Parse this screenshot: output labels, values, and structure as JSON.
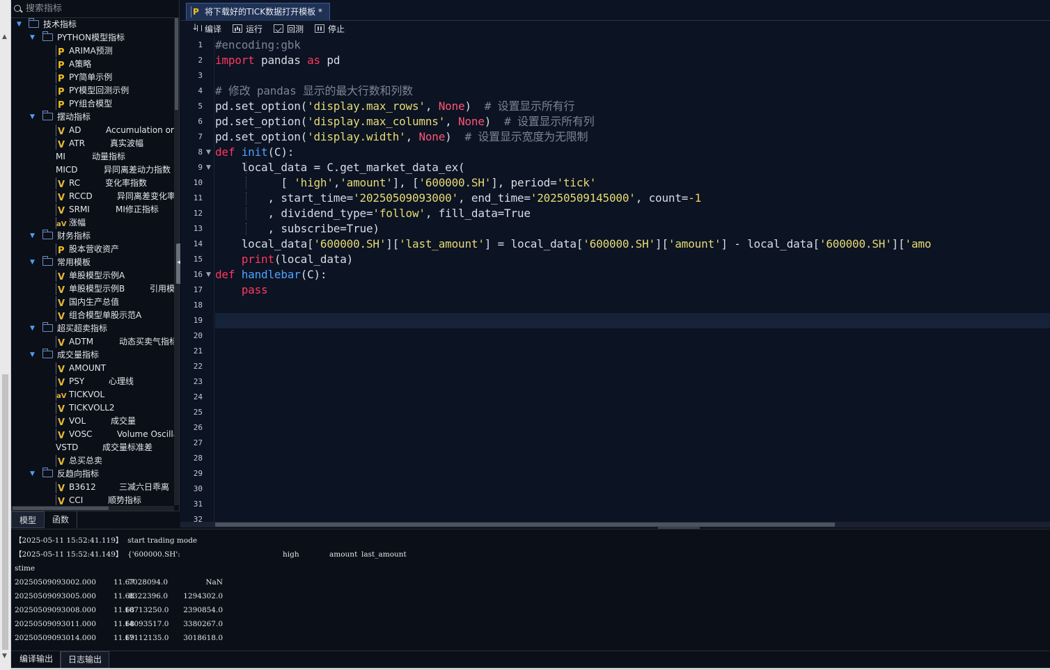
{
  "search": {
    "placeholder": "搜索指标"
  },
  "tree": [
    {
      "type": "group",
      "level": 0,
      "label": "技术指标"
    },
    {
      "type": "group",
      "level": 1,
      "label": "PYTHON模型指标"
    },
    {
      "type": "item",
      "icon": "p",
      "label": "ARIMA预测",
      "desc": ""
    },
    {
      "type": "item",
      "icon": "p",
      "label": "A策略",
      "desc": ""
    },
    {
      "type": "item",
      "icon": "p",
      "label": "PY简单示例",
      "desc": ""
    },
    {
      "type": "item",
      "icon": "p",
      "label": "PY模型回测示例",
      "desc": ""
    },
    {
      "type": "item",
      "icon": "p",
      "label": "PY组合模型",
      "desc": ""
    },
    {
      "type": "group",
      "level": 1,
      "label": "摆动指标"
    },
    {
      "type": "item",
      "icon": "v",
      "label": "AD",
      "desc": "Accumulation or"
    },
    {
      "type": "item",
      "icon": "v",
      "label": "ATR",
      "desc": "真实波幅"
    },
    {
      "type": "item",
      "icon": "none",
      "label": "MI",
      "desc": "动量指标"
    },
    {
      "type": "item",
      "icon": "none",
      "label": "MICD",
      "desc": "异同离差动力指数"
    },
    {
      "type": "item",
      "icon": "v",
      "label": "RC",
      "desc": "变化率指数"
    },
    {
      "type": "item",
      "icon": "v",
      "label": "RCCD",
      "desc": "异同离差变化率"
    },
    {
      "type": "item",
      "icon": "v",
      "label": "SRMI",
      "desc": "MI修正指标"
    },
    {
      "type": "item",
      "icon": "av",
      "label": "涨幅",
      "desc": ""
    },
    {
      "type": "group",
      "level": 1,
      "label": "财务指标"
    },
    {
      "type": "item",
      "icon": "p",
      "label": "股本营收资产",
      "desc": ""
    },
    {
      "type": "group",
      "level": 1,
      "label": "常用模板"
    },
    {
      "type": "item",
      "icon": "v",
      "label": "单股模型示例A",
      "desc": ""
    },
    {
      "type": "item",
      "icon": "v",
      "label": "单股模型示例B",
      "desc": "引用模"
    },
    {
      "type": "item",
      "icon": "v",
      "label": "国内生产总值",
      "desc": ""
    },
    {
      "type": "item",
      "icon": "v",
      "label": "组合模型单股示范A",
      "desc": ""
    },
    {
      "type": "group",
      "level": 1,
      "label": "超买超卖指标"
    },
    {
      "type": "item",
      "icon": "v",
      "label": "ADTM",
      "desc": "动态买卖气指标"
    },
    {
      "type": "group",
      "level": 1,
      "label": "成交量指标"
    },
    {
      "type": "item",
      "icon": "v",
      "label": "AMOUNT",
      "desc": ""
    },
    {
      "type": "item",
      "icon": "v",
      "label": "PSY",
      "desc": "心理线"
    },
    {
      "type": "item",
      "icon": "av",
      "label": "TICKVOL",
      "desc": ""
    },
    {
      "type": "item",
      "icon": "v",
      "label": "TICKVOLL2",
      "desc": ""
    },
    {
      "type": "item",
      "icon": "v",
      "label": "VOL",
      "desc": "成交量"
    },
    {
      "type": "item",
      "icon": "v",
      "label": "VOSC",
      "desc": "Volume Oscilla"
    },
    {
      "type": "item",
      "icon": "none",
      "label": "VSTD",
      "desc": "成交量标准差"
    },
    {
      "type": "item",
      "icon": "v",
      "label": "总买总卖",
      "desc": ""
    },
    {
      "type": "group",
      "level": 1,
      "label": "反趋向指标"
    },
    {
      "type": "item",
      "icon": "v",
      "label": "B3612",
      "desc": "三减六日乖离"
    },
    {
      "type": "item",
      "icon": "v",
      "label": "CCI",
      "desc": "顺势指标"
    }
  ],
  "left_tabs": [
    "模型",
    "函数"
  ],
  "editor": {
    "tab_title": "将下载好的TICK数据打开模板 *",
    "toolbar": {
      "compile": "编译",
      "run": "运行",
      "backtest": "回测",
      "stop": "停止"
    }
  },
  "code_lines": [
    [
      [
        "c",
        "#encoding:gbk"
      ]
    ],
    [
      [
        "k",
        "import"
      ],
      [
        "pl",
        " pandas "
      ],
      [
        "k",
        "as"
      ],
      [
        "pl",
        " pd"
      ]
    ],
    [],
    [
      [
        "c",
        "# 修改 pandas 显示的最大行数和列数"
      ]
    ],
    [
      [
        "pl",
        "pd.set_option("
      ],
      [
        "s",
        "'display.max_rows'"
      ],
      [
        "pl",
        ", "
      ],
      [
        "cst",
        "None"
      ],
      [
        "pl",
        ")  "
      ],
      [
        "c",
        "# 设置显示所有行"
      ]
    ],
    [
      [
        "pl",
        "pd.set_option("
      ],
      [
        "s",
        "'display.max_columns'"
      ],
      [
        "pl",
        ", "
      ],
      [
        "cst",
        "None"
      ],
      [
        "pl",
        ")  "
      ],
      [
        "c",
        "# 设置显示所有列"
      ]
    ],
    [
      [
        "pl",
        "pd.set_option("
      ],
      [
        "s",
        "'display.width'"
      ],
      [
        "pl",
        ", "
      ],
      [
        "cst",
        "None"
      ],
      [
        "pl",
        ")  "
      ],
      [
        "c",
        "# 设置显示宽度为无限制"
      ]
    ],
    [
      [
        "k",
        "def"
      ],
      [
        "pl",
        " "
      ],
      [
        "f",
        "init"
      ],
      [
        "pl",
        "(C):"
      ]
    ],
    [
      [
        "pl",
        "    local_data = C.get_market_data_ex("
      ]
    ],
    [
      [
        "pl",
        "          [ "
      ],
      [
        "s",
        "'high'"
      ],
      [
        "pl",
        ","
      ],
      [
        "s",
        "'amount'"
      ],
      [
        "pl",
        "], ["
      ],
      [
        "s",
        "'600000.SH'"
      ],
      [
        "pl",
        "], period="
      ],
      [
        "s",
        "'tick'"
      ]
    ],
    [
      [
        "pl",
        "        , start_time="
      ],
      [
        "s",
        "'20250509093000'"
      ],
      [
        "pl",
        ", end_time="
      ],
      [
        "s",
        "'20250509145000'"
      ],
      [
        "pl",
        ", count="
      ],
      [
        "n",
        "-1"
      ]
    ],
    [
      [
        "pl",
        "        , dividend_type="
      ],
      [
        "s",
        "'follow'"
      ],
      [
        "pl",
        ", fill_data=True"
      ]
    ],
    [
      [
        "pl",
        "        , subscribe=True)"
      ]
    ],
    [
      [
        "pl",
        "    local_data["
      ],
      [
        "s",
        "'600000.SH'"
      ],
      [
        "pl",
        "]["
      ],
      [
        "s",
        "'last_amount'"
      ],
      [
        "pl",
        "] = local_data["
      ],
      [
        "s",
        "'600000.SH'"
      ],
      [
        "pl",
        "]["
      ],
      [
        "s",
        "'amount'"
      ],
      [
        "pl",
        "] - local_data["
      ],
      [
        "s",
        "'600000.SH'"
      ],
      [
        "pl",
        "]["
      ],
      [
        "s",
        "'amo"
      ]
    ],
    [
      [
        "pl",
        "    "
      ],
      [
        "k",
        "print"
      ],
      [
        "pl",
        "(local_data)"
      ]
    ],
    [
      [
        "k",
        "def"
      ],
      [
        "pl",
        " "
      ],
      [
        "f",
        "handlebar"
      ],
      [
        "pl",
        "(C):"
      ]
    ],
    [
      [
        "pl",
        "    "
      ],
      [
        "k",
        "pass"
      ]
    ],
    [],
    [
      [
        "ws",
        "    "
      ]
    ],
    [
      [
        "ws",
        "    "
      ]
    ],
    [
      [
        "ws",
        "    "
      ]
    ],
    [
      [
        "ws",
        "    "
      ]
    ],
    [
      [
        "ws",
        "    "
      ]
    ],
    [
      [
        "ws",
        "    "
      ]
    ],
    [
      [
        "ws",
        "    "
      ]
    ],
    [
      [
        "ws",
        "    "
      ]
    ],
    [
      [
        "ws",
        "    "
      ]
    ],
    [],
    [],
    [],
    [],
    []
  ],
  "line_numbers": [
    "1",
    "2",
    "3",
    "4",
    "5",
    "6",
    "7",
    "8",
    "9",
    "10",
    "11",
    "12",
    "13",
    "14",
    "15",
    "16",
    "17",
    "18",
    "19",
    "20",
    "21",
    "22",
    "23",
    "24",
    "25",
    "26",
    "27",
    "28",
    "29",
    "30",
    "31",
    "32"
  ],
  "console": {
    "lines": [
      [
        "【2025-05-11 15:52:41.119】  start trading mode"
      ],
      [
        "【2025-05-11 15:52:41.149】  {'600000.SH':",
        "high",
        "amount",
        "last_amount"
      ],
      [
        "stime"
      ],
      [
        "20250509093002.000",
        "11.67",
        "7028094.0",
        "NaN"
      ],
      [
        "20250509093005.000",
        "11.68",
        "8322396.0",
        "1294302.0"
      ],
      [
        "20250509093008.000",
        "11.68",
        "10713250.0",
        "2390854.0"
      ],
      [
        "20250509093011.000",
        "11.68",
        "14093517.0",
        "3380267.0"
      ],
      [
        "20250509093014.000",
        "11.69",
        "17112135.0",
        "3018618.0"
      ]
    ]
  },
  "bottom_tabs": [
    "编译输出",
    "日志输出"
  ],
  "colors": {
    "accent": "#1f3256",
    "keyword": "#ff3860",
    "string": "#e6db74",
    "function": "#4ea3ff",
    "comment": "#7c8595"
  }
}
